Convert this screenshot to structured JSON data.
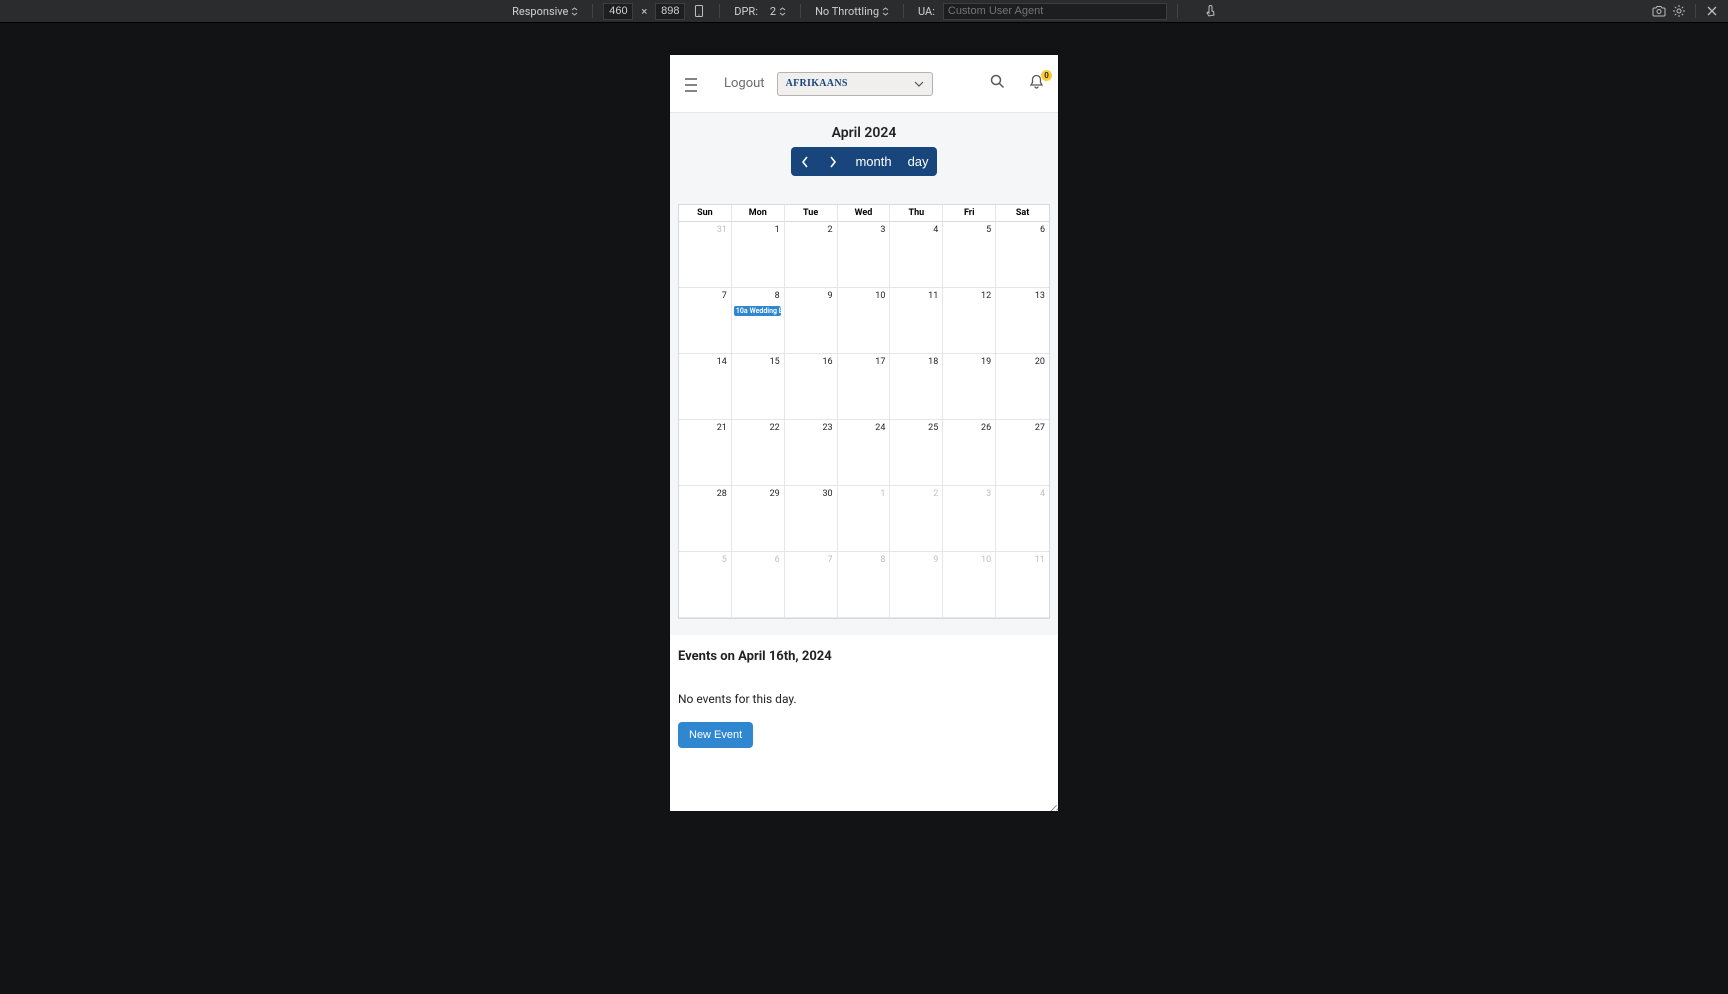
{
  "devtools": {
    "responsive_label": "Responsive",
    "width_value": "460",
    "height_value": "898",
    "dimension_sep": "×",
    "dpr_label": "DPR:",
    "dpr_value": "2",
    "throttling_value": "No Throttling",
    "ua_label": "UA:",
    "ua_placeholder": "Custom User Agent"
  },
  "header": {
    "logout_label": "Logout",
    "language_selected": "AFRIKAANS",
    "notif_count": "0"
  },
  "calendar": {
    "title": "April 2024",
    "controls": {
      "month_label": "month",
      "day_label": "day"
    },
    "weekdays": [
      "Sun",
      "Mon",
      "Tue",
      "Wed",
      "Thu",
      "Fri",
      "Sat"
    ],
    "cells": [
      {
        "n": "31",
        "off": true
      },
      {
        "n": "1"
      },
      {
        "n": "2"
      },
      {
        "n": "3"
      },
      {
        "n": "4"
      },
      {
        "n": "5"
      },
      {
        "n": "6"
      },
      {
        "n": "7"
      },
      {
        "n": "8",
        "event": {
          "time": "10a",
          "title": "Wedding B"
        }
      },
      {
        "n": "9"
      },
      {
        "n": "10"
      },
      {
        "n": "11"
      },
      {
        "n": "12"
      },
      {
        "n": "13"
      },
      {
        "n": "14"
      },
      {
        "n": "15"
      },
      {
        "n": "16"
      },
      {
        "n": "17"
      },
      {
        "n": "18"
      },
      {
        "n": "19"
      },
      {
        "n": "20"
      },
      {
        "n": "21"
      },
      {
        "n": "22"
      },
      {
        "n": "23"
      },
      {
        "n": "24"
      },
      {
        "n": "25"
      },
      {
        "n": "26"
      },
      {
        "n": "27"
      },
      {
        "n": "28"
      },
      {
        "n": "29"
      },
      {
        "n": "30"
      },
      {
        "n": "1",
        "off": true
      },
      {
        "n": "2",
        "off": true
      },
      {
        "n": "3",
        "off": true
      },
      {
        "n": "4",
        "off": true
      },
      {
        "n": "5",
        "off": true
      },
      {
        "n": "6",
        "off": true
      },
      {
        "n": "7",
        "off": true
      },
      {
        "n": "8",
        "off": true
      },
      {
        "n": "9",
        "off": true
      },
      {
        "n": "10",
        "off": true
      },
      {
        "n": "11",
        "off": true
      }
    ]
  },
  "events_section": {
    "heading": "Events on April 16th, 2024",
    "empty_message": "No events for this day.",
    "new_event_label": "New Event"
  }
}
